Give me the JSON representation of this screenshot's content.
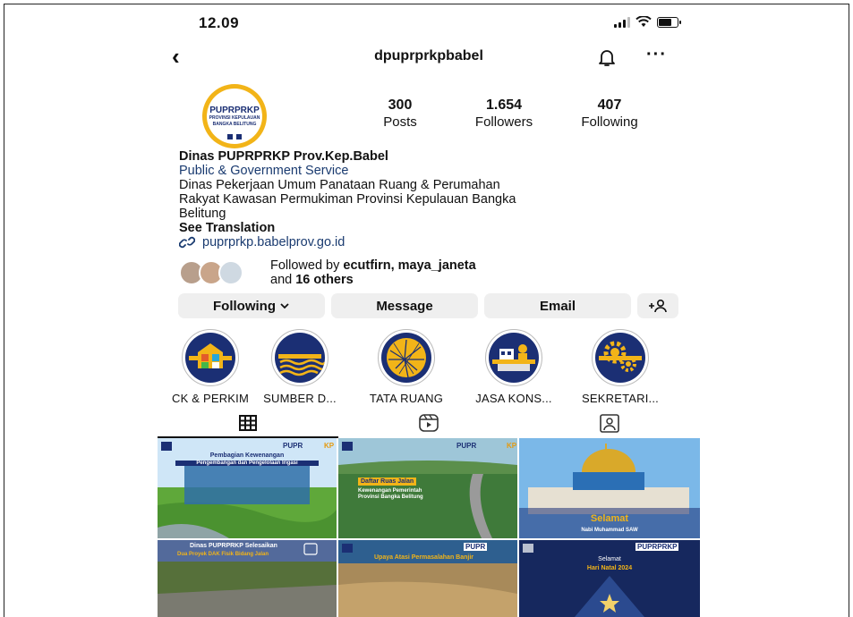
{
  "status": {
    "time": "12.09"
  },
  "header": {
    "username": "dpuprprkpbabel"
  },
  "profile": {
    "avatar_brand": "PUPRPRKP",
    "avatar_subtitle_1": "PROVINSI KEPULAUAN",
    "avatar_subtitle_2": "BANGKA BELITUNG",
    "stats": [
      {
        "value": "300",
        "label": "Posts"
      },
      {
        "value": "1.654",
        "label": "Followers"
      },
      {
        "value": "407",
        "label": "Following"
      }
    ],
    "name": "Dinas PUPRPRKP Prov.Kep.Babel",
    "category": "Public & Government Service",
    "description": "Dinas Pekerjaan Umum Panataan Ruang & Perumahan\nRakyat Kawasan Permukiman Provinsi Kepulauan Bangka\nBelitung",
    "see_translation": "See Translation",
    "link": "puprprkp.babelprov.go.id"
  },
  "followed_by": {
    "prefix": "Followed by",
    "users": "ecutfirn, maya_janeta",
    "and": "and",
    "others": "16 others"
  },
  "buttons": {
    "following": "Following",
    "message": "Message",
    "email": "Email"
  },
  "highlights": [
    {
      "label": "CK & PERKIM"
    },
    {
      "label": "SUMBER D..."
    },
    {
      "label": "TATA RUANG"
    },
    {
      "label": "JASA KONS..."
    },
    {
      "label": "SEKRETARI..."
    }
  ],
  "posts": [
    {
      "brand": "PUPR",
      "brand_suffix": "KP",
      "title": "Pembagian Kewenangan",
      "subtitle": "Pengembangan dan Pengelolaan Irigasi"
    },
    {
      "brand": "PUPR",
      "brand_suffix": "KP",
      "title": "Daftar Ruas Jalan",
      "subtitle": "Kewenangan Pemerintah Provinsi Bangka Belitung"
    },
    {
      "title": "Selamat",
      "subtitle": "Nabi Muhammad SAW"
    },
    {
      "title": "Dinas PUPRPRKP Selesaikan",
      "subtitle": "Dua Proyek DAK Fisik Bidang Jalan"
    },
    {
      "brand": "PUPR",
      "title": "Upaya Atasi Permasalahan Banjir"
    },
    {
      "brand": "PUPRPRKP",
      "title": "Selamat",
      "subtitle": "Hari Natal 2024"
    }
  ],
  "colors": {
    "link": "#1a3b70",
    "button_bg": "#efefef",
    "badge_navy": "#1b2f74",
    "badge_gold": "#f2b418"
  }
}
